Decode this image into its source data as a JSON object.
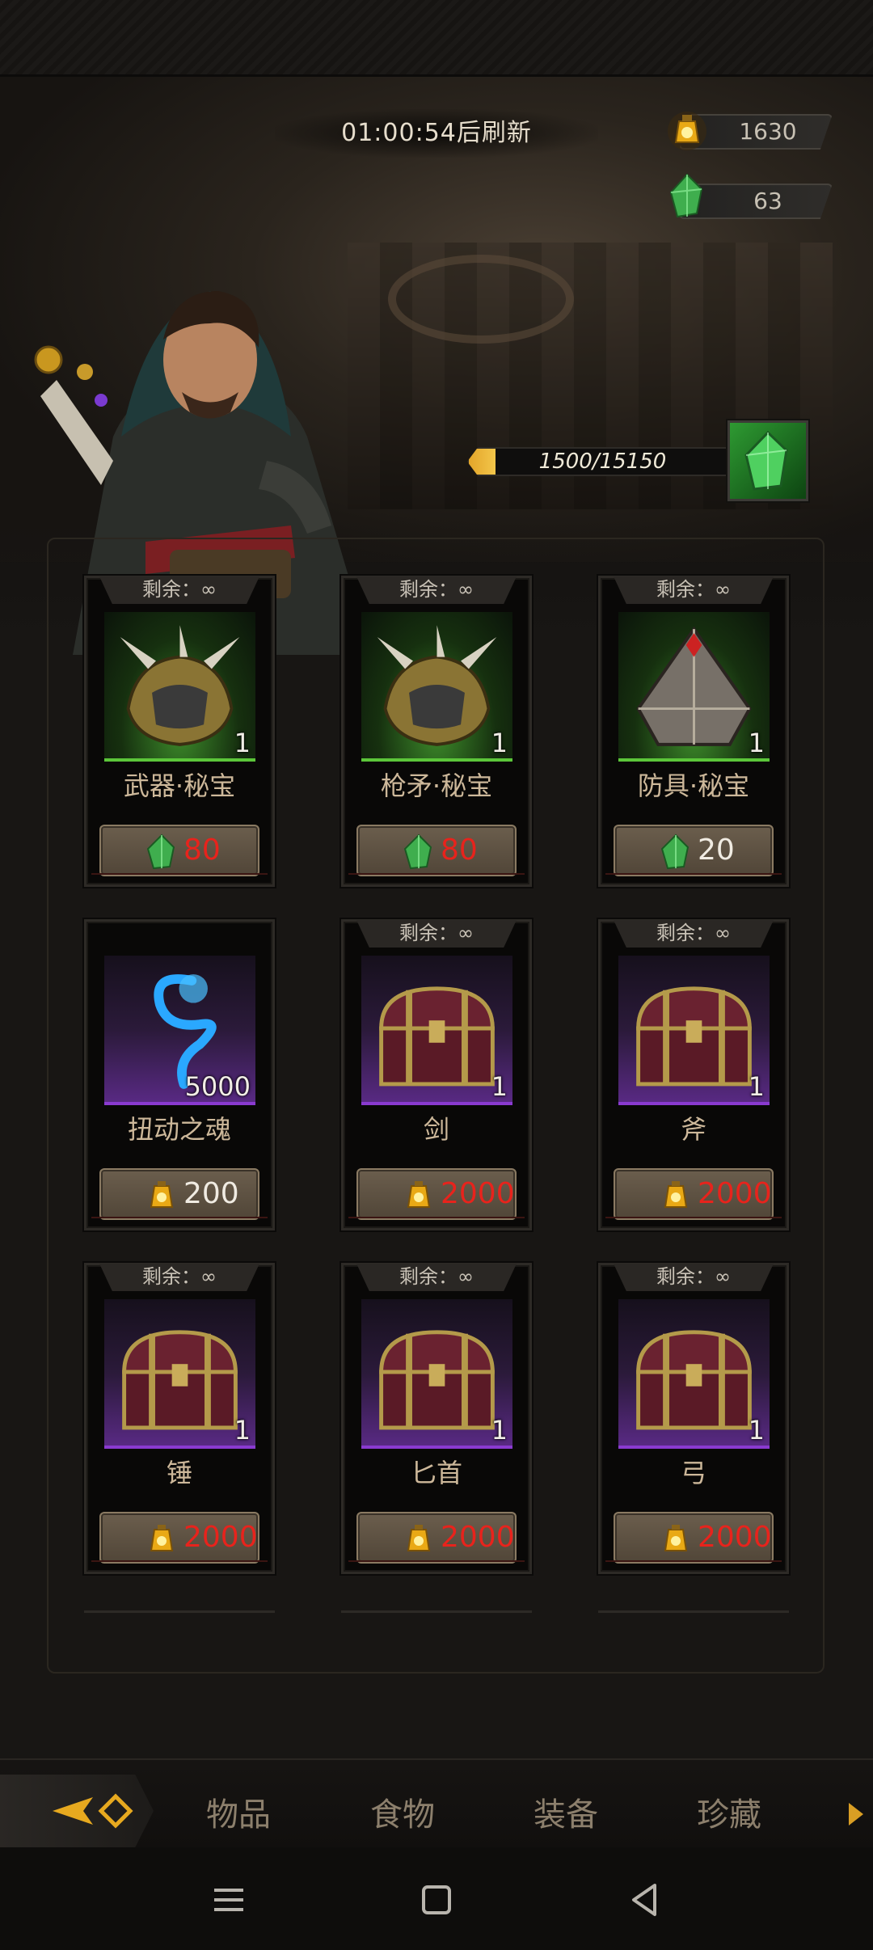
{
  "header": {
    "refresh_timer": "01:00:54后刷新",
    "gold": "1630",
    "gems": "63"
  },
  "progress": {
    "text": "1500/15150",
    "current": 1500,
    "max": 15150,
    "reward_icon": "green-crystal-icon"
  },
  "shop_items": [
    {
      "remaining": "剩余：∞",
      "name": "武器·秘宝",
      "qty": "1",
      "price": "80",
      "currency": "gem",
      "price_color": "red",
      "rarity": "green",
      "icon": "spiked-armor-icon"
    },
    {
      "remaining": "剩余：∞",
      "name": "枪矛·秘宝",
      "qty": "1",
      "price": "80",
      "currency": "gem",
      "price_color": "red",
      "rarity": "green",
      "icon": "spiked-armor-icon"
    },
    {
      "remaining": "剩余：∞",
      "name": "防具·秘宝",
      "qty": "1",
      "price": "20",
      "currency": "gem",
      "price_color": "white",
      "rarity": "green",
      "icon": "armor-pyramid-icon"
    },
    {
      "remaining": "",
      "name": "扭动之魂",
      "qty": "5000",
      "price": "200",
      "currency": "gold",
      "price_color": "white",
      "rarity": "purple",
      "icon": "blue-soul-icon"
    },
    {
      "remaining": "剩余：∞",
      "name": "剑",
      "qty": "1",
      "price": "2000",
      "currency": "gold",
      "price_color": "red",
      "rarity": "purple",
      "icon": "treasure-chest-icon"
    },
    {
      "remaining": "剩余：∞",
      "name": "斧",
      "qty": "1",
      "price": "2000",
      "currency": "gold",
      "price_color": "red",
      "rarity": "purple",
      "icon": "treasure-chest-icon"
    },
    {
      "remaining": "剩余：∞",
      "name": "锤",
      "qty": "1",
      "price": "2000",
      "currency": "gold",
      "price_color": "red",
      "rarity": "purple",
      "icon": "treasure-chest-icon"
    },
    {
      "remaining": "剩余：∞",
      "name": "匕首",
      "qty": "1",
      "price": "2000",
      "currency": "gold",
      "price_color": "red",
      "rarity": "purple",
      "icon": "treasure-chest-icon"
    },
    {
      "remaining": "剩余：∞",
      "name": "弓",
      "qty": "1",
      "price": "2000",
      "currency": "gold",
      "price_color": "red",
      "rarity": "purple",
      "icon": "treasure-chest-icon"
    }
  ],
  "tabs": [
    {
      "label": "物品"
    },
    {
      "label": "食物"
    },
    {
      "label": "装备"
    },
    {
      "label": "珍藏"
    }
  ],
  "colors": {
    "price_red": "#e8231c",
    "gold_accent": "#d99e24",
    "rarity_green": "#5cc63a",
    "rarity_purple": "#8a3ad0"
  }
}
